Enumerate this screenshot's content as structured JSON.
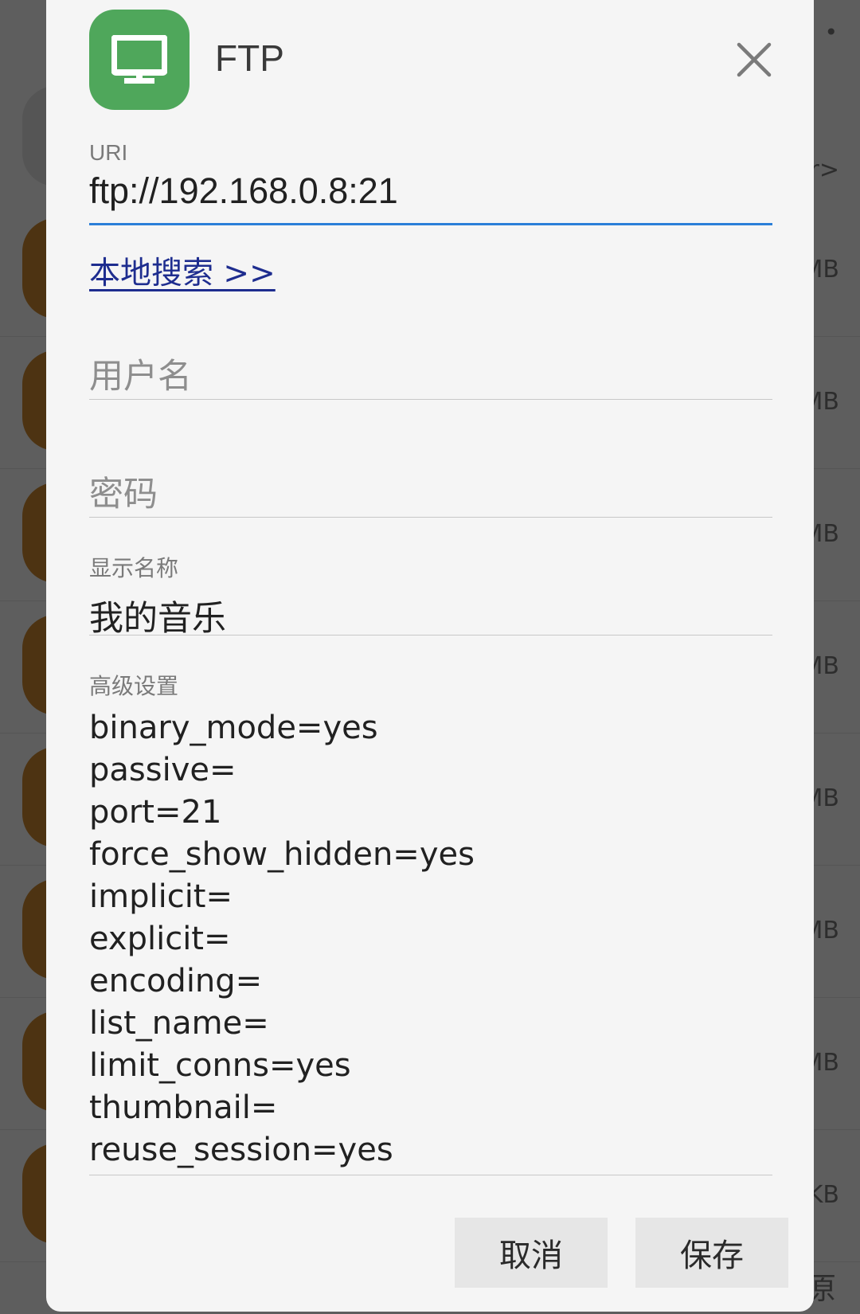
{
  "background": {
    "top_text": "r>",
    "rows": [
      {
        "size": "MB"
      },
      {
        "size": "MB"
      },
      {
        "size": "MB"
      },
      {
        "size": "MB"
      },
      {
        "size": "MB"
      },
      {
        "size": "MB"
      },
      {
        "size": "MB"
      },
      {
        "size": "KB"
      }
    ],
    "bottom_char": "原"
  },
  "dialog": {
    "title": "FTP",
    "app_icon": "monitor-icon",
    "accent_color": "#4fa75b",
    "uri": {
      "label": "URI",
      "value": "ftp://192.168.0.8:21"
    },
    "local_search_link": "本地搜索 >>",
    "username": {
      "placeholder": "用户名",
      "value": ""
    },
    "password": {
      "placeholder": "密码",
      "value": ""
    },
    "display_name": {
      "label": "显示名称",
      "value": "我的音乐"
    },
    "advanced": {
      "label": "高级设置",
      "lines": [
        "binary_mode=yes",
        "passive=",
        "port=21",
        "force_show_hidden=yes",
        "implicit=",
        "explicit=",
        "encoding=",
        "list_name=",
        "limit_conns=yes",
        "thumbnail=",
        "reuse_session=yes"
      ]
    },
    "buttons": {
      "cancel": "取消",
      "save": "保存"
    }
  }
}
